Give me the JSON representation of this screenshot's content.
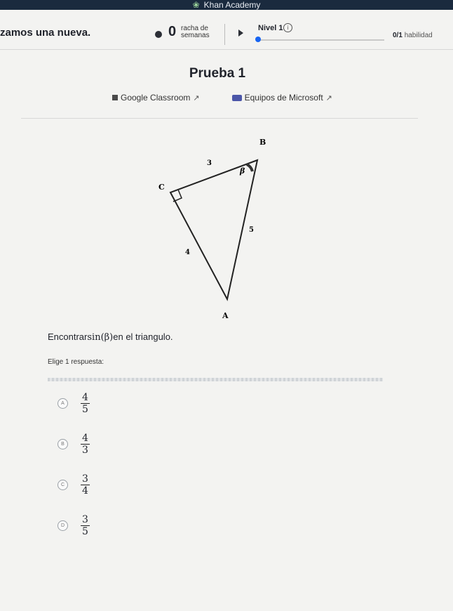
{
  "topbar": {
    "brand": "Khan Academy"
  },
  "header": {
    "title": "zamos una nueva.",
    "streak_count": "0",
    "streak_label": "racha de semanas",
    "level_label": "Nivel 1",
    "skills_count": "0/1",
    "skills_label": "habilidad"
  },
  "quiz": {
    "title": "Prueba 1",
    "google_classroom": "Google Classroom",
    "ms_teams": "Equipos de Microsoft"
  },
  "triangle": {
    "vertices": {
      "A": "A",
      "B": "B",
      "C": "C"
    },
    "angle_label": "β",
    "side_cb": "3",
    "side_ca": "4",
    "side_ab": "5"
  },
  "question": {
    "prompt_pre": "Encontrar",
    "prompt_math": "sin(β)",
    "prompt_post": "en el triangulo.",
    "choose": "Elige 1 respuesta:"
  },
  "choices": [
    {
      "letter": "A",
      "num": "4",
      "den": "5"
    },
    {
      "letter": "B",
      "num": "4",
      "den": "3"
    },
    {
      "letter": "C",
      "num": "3",
      "den": "4"
    },
    {
      "letter": "D",
      "num": "3",
      "den": "5"
    }
  ],
  "colors": {
    "accent": "#1865f2",
    "topbar": "#1a2a3e"
  }
}
